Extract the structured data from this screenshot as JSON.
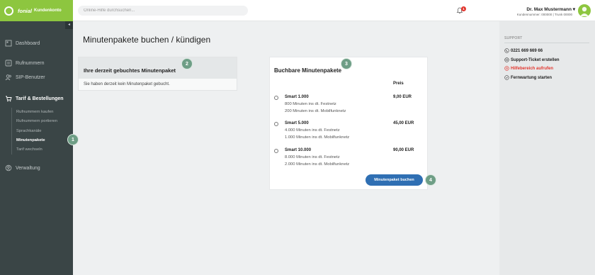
{
  "header": {
    "brand_word": "fonial",
    "brand_sub": "Kundenkonto",
    "search_placeholder": "Online-Hilfe durchsuchen...",
    "notification_count": "1",
    "user_name": "Dr. Max Mustermann ▾",
    "user_sub": "Kundennummer: 000000 | Trunk 00000"
  },
  "sidebar": {
    "collapse_glyph": "◂",
    "items": [
      {
        "label": "Dashboard",
        "icon": "dashboard-icon"
      },
      {
        "label": "Rufnummern",
        "icon": "phone-numbers-icon"
      },
      {
        "label": "SIP-Benutzer",
        "icon": "users-icon"
      },
      {
        "label": "Tarif & Bestellungen",
        "icon": "cart-icon"
      },
      {
        "label": "Verwaltung",
        "icon": "settings-icon"
      }
    ],
    "subitems": [
      {
        "label": "Rufnummern kaufen"
      },
      {
        "label": "Rufnummern portieren"
      },
      {
        "label": "Sprachkanäle"
      },
      {
        "label": "Minutenpakete"
      },
      {
        "label": "Tarif wechseln"
      }
    ]
  },
  "main": {
    "title": "Minutenpakete buchen / kündigen",
    "current": {
      "heading": "Ihre derzeit gebuchtes Minutenpaket",
      "text": "Sie haben derzeit kein Minutenpaket gebucht."
    },
    "available": {
      "heading": "Buchbare Minutenpakete",
      "price_header": "Preis",
      "packages": [
        {
          "name": "Smart 1.000",
          "price": "9,00 EUR",
          "lines": [
            "800 Minuten ins dt. Festnetz",
            "200 Minuten ins dt. Mobilfunknetz"
          ]
        },
        {
          "name": "Smart 5.000",
          "price": "45,00 EUR",
          "lines": [
            "4.000 Minuten ins dt. Festnetz",
            "1.000 Minuten ins dt. Mobilfunknetz"
          ]
        },
        {
          "name": "Smart 10.000",
          "price": "90,00 EUR",
          "lines": [
            "8.000 Minuten ins dt. Festnetz",
            "2.000 Minuten ins dt. Mobilfunknetz"
          ]
        }
      ],
      "button": "Minutenpaket buchen"
    },
    "steps": [
      "1",
      "2",
      "3",
      "4"
    ]
  },
  "support": {
    "title": "SUPPORT",
    "items": [
      {
        "label": "0221 669 669 66",
        "icon": "phone-icon",
        "color": "#222222"
      },
      {
        "label": "Support-Ticket erstellen",
        "icon": "ticket-icon",
        "color": "#222222"
      },
      {
        "label": "Hilfebereich aufrufen",
        "icon": "help-icon",
        "color": "#e2372f"
      },
      {
        "label": "Fernwartung starten",
        "icon": "remote-icon",
        "color": "#222222"
      }
    ]
  },
  "colors": {
    "brand_green": "#8dc63f",
    "sidebar_bg": "#3a4546",
    "primary_button": "#2f6fb3",
    "step_badge": "#6e9e86",
    "alert_red": "#e2372f"
  }
}
